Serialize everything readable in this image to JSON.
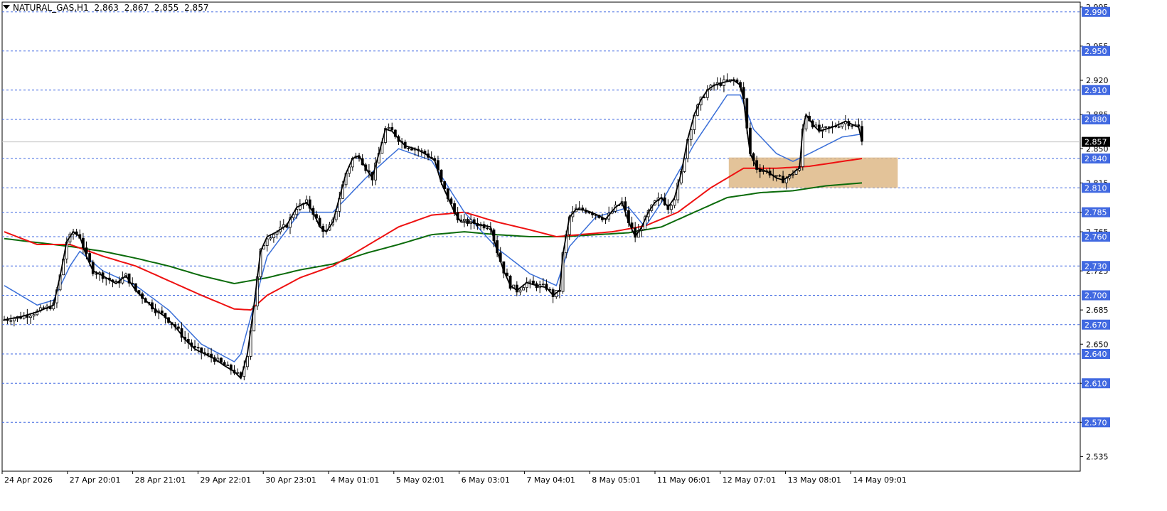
{
  "header": {
    "symbol": "NATURAL_GAS,H1",
    "open": "2.863",
    "high": "2.867",
    "low": "2.855",
    "close": "2.857"
  },
  "colors": {
    "candle": "#000000",
    "level_line": "#4169E1",
    "level_label_bg": "#4169E1",
    "price_label_bg": "#000000",
    "ma_fast": "#000000",
    "ma_blue": "#3a6fd8",
    "ma_red": "#ee1111",
    "ma_green": "#0b6b0b",
    "zone_fill": "#deb887"
  },
  "chart_data": {
    "type": "candlestick",
    "timeframe": "H1",
    "ylim": [
      2.52,
      3.0
    ],
    "y_ticks": [
      "2.995",
      "2.955",
      "2.920",
      "2.885",
      "2.850",
      "2.815",
      "2.785",
      "2.765",
      "2.725",
      "2.685",
      "2.650",
      "2.610",
      "2.570",
      "2.535"
    ],
    "x_ticks": [
      "24 Apr 2026",
      "27 Apr 20:01",
      "28 Apr 21:01",
      "29 Apr 22:01",
      "30 Apr 23:01",
      "4 May 01:01",
      "5 May 02:01",
      "6 May 03:01",
      "7 May 04:01",
      "8 May 05:01",
      "11 May 06:01",
      "12 May 07:01",
      "13 May 08:01",
      "14 May 09:01"
    ],
    "levels": [
      "2.990",
      "2.950",
      "2.910",
      "2.880",
      "2.840",
      "2.810",
      "2.785",
      "2.760",
      "2.730",
      "2.700",
      "2.670",
      "2.640",
      "2.610",
      "2.570"
    ],
    "current_price": "2.857",
    "zone": {
      "from_label": "12 May 07:01",
      "to_label": "14 May 09:01",
      "top": 2.841,
      "bottom": 2.81
    },
    "close_path": [
      [
        0,
        2.675
      ],
      [
        5,
        2.678
      ],
      [
        10,
        2.683
      ],
      [
        15,
        2.69
      ],
      [
        17,
        2.72
      ],
      [
        19,
        2.755
      ],
      [
        21,
        2.765
      ],
      [
        23,
        2.76
      ],
      [
        25,
        2.74
      ],
      [
        27,
        2.725
      ],
      [
        30,
        2.72
      ],
      [
        34,
        2.712
      ],
      [
        37,
        2.72
      ],
      [
        40,
        2.705
      ],
      [
        43,
        2.695
      ],
      [
        46,
        2.685
      ],
      [
        49,
        2.678
      ],
      [
        52,
        2.668
      ],
      [
        55,
        2.655
      ],
      [
        58,
        2.645
      ],
      [
        61,
        2.64
      ],
      [
        64,
        2.635
      ],
      [
        67,
        2.628
      ],
      [
        70,
        2.622
      ],
      [
        72,
        2.615
      ],
      [
        74,
        2.64
      ],
      [
        76,
        2.69
      ],
      [
        78,
        2.745
      ],
      [
        80,
        2.76
      ],
      [
        83,
        2.765
      ],
      [
        86,
        2.772
      ],
      [
        89,
        2.79
      ],
      [
        92,
        2.795
      ],
      [
        94,
        2.785
      ],
      [
        96,
        2.77
      ],
      [
        98,
        2.765
      ],
      [
        100,
        2.775
      ],
      [
        102,
        2.8
      ],
      [
        104,
        2.825
      ],
      [
        106,
        2.84
      ],
      [
        108,
        2.843
      ],
      [
        110,
        2.83
      ],
      [
        112,
        2.82
      ],
      [
        114,
        2.845
      ],
      [
        116,
        2.87
      ],
      [
        118,
        2.868
      ],
      [
        120,
        2.86
      ],
      [
        122,
        2.853
      ],
      [
        125,
        2.85
      ],
      [
        128,
        2.845
      ],
      [
        131,
        2.838
      ],
      [
        133,
        2.815
      ],
      [
        135,
        2.8
      ],
      [
        137,
        2.785
      ],
      [
        139,
        2.775
      ],
      [
        142,
        2.775
      ],
      [
        145,
        2.772
      ],
      [
        148,
        2.77
      ],
      [
        150,
        2.745
      ],
      [
        152,
        2.725
      ],
      [
        154,
        2.71
      ],
      [
        156,
        2.705
      ],
      [
        159,
        2.713
      ],
      [
        162,
        2.71
      ],
      [
        165,
        2.708
      ],
      [
        167,
        2.7
      ],
      [
        169,
        2.705
      ],
      [
        170,
        2.742
      ],
      [
        172,
        2.78
      ],
      [
        174,
        2.788
      ],
      [
        177,
        2.787
      ],
      [
        180,
        2.783
      ],
      [
        183,
        2.778
      ],
      [
        186,
        2.79
      ],
      [
        188,
        2.795
      ],
      [
        190,
        2.775
      ],
      [
        192,
        2.76
      ],
      [
        194,
        2.77
      ],
      [
        196,
        2.785
      ],
      [
        198,
        2.795
      ],
      [
        200,
        2.8
      ],
      [
        202,
        2.79
      ],
      [
        204,
        2.8
      ],
      [
        206,
        2.825
      ],
      [
        208,
        2.86
      ],
      [
        210,
        2.885
      ],
      [
        212,
        2.9
      ],
      [
        214,
        2.91
      ],
      [
        216,
        2.915
      ],
      [
        219,
        2.918
      ],
      [
        222,
        2.92
      ],
      [
        224,
        2.915
      ],
      [
        225,
        2.9
      ],
      [
        226,
        2.87
      ],
      [
        227,
        2.845
      ],
      [
        229,
        2.83
      ],
      [
        231,
        2.828
      ],
      [
        233,
        2.825
      ],
      [
        235,
        2.82
      ],
      [
        237,
        2.818
      ],
      [
        239,
        2.822
      ],
      [
        241,
        2.828
      ],
      [
        242,
        2.83
      ],
      [
        243,
        2.87
      ],
      [
        244,
        2.885
      ],
      [
        246,
        2.875
      ],
      [
        248,
        2.868
      ],
      [
        250,
        2.87
      ],
      [
        252,
        2.872
      ],
      [
        254,
        2.875
      ],
      [
        256,
        2.878
      ],
      [
        258,
        2.875
      ],
      [
        260,
        2.872
      ],
      [
        261,
        2.857
      ]
    ],
    "ma_paths": {
      "blue": [
        [
          0,
          2.71
        ],
        [
          10,
          2.69
        ],
        [
          15,
          2.695
        ],
        [
          20,
          2.73
        ],
        [
          23,
          2.745
        ],
        [
          30,
          2.725
        ],
        [
          40,
          2.71
        ],
        [
          50,
          2.685
        ],
        [
          60,
          2.65
        ],
        [
          70,
          2.632
        ],
        [
          72,
          2.64
        ],
        [
          76,
          2.69
        ],
        [
          80,
          2.74
        ],
        [
          90,
          2.785
        ],
        [
          100,
          2.785
        ],
        [
          110,
          2.82
        ],
        [
          120,
          2.85
        ],
        [
          130,
          2.838
        ],
        [
          140,
          2.785
        ],
        [
          150,
          2.748
        ],
        [
          160,
          2.722
        ],
        [
          168,
          2.71
        ],
        [
          172,
          2.75
        ],
        [
          180,
          2.78
        ],
        [
          190,
          2.79
        ],
        [
          195,
          2.77
        ],
        [
          200,
          2.795
        ],
        [
          210,
          2.855
        ],
        [
          220,
          2.905
        ],
        [
          224,
          2.905
        ],
        [
          228,
          2.87
        ],
        [
          235,
          2.845
        ],
        [
          240,
          2.837
        ],
        [
          245,
          2.845
        ],
        [
          255,
          2.862
        ],
        [
          261,
          2.865
        ]
      ],
      "red": [
        [
          0,
          2.765
        ],
        [
          10,
          2.752
        ],
        [
          20,
          2.752
        ],
        [
          30,
          2.74
        ],
        [
          40,
          2.73
        ],
        [
          50,
          2.715
        ],
        [
          60,
          2.7
        ],
        [
          70,
          2.686
        ],
        [
          75,
          2.685
        ],
        [
          80,
          2.7
        ],
        [
          90,
          2.718
        ],
        [
          100,
          2.73
        ],
        [
          110,
          2.75
        ],
        [
          120,
          2.77
        ],
        [
          130,
          2.782
        ],
        [
          140,
          2.785
        ],
        [
          150,
          2.775
        ],
        [
          160,
          2.767
        ],
        [
          168,
          2.76
        ],
        [
          175,
          2.762
        ],
        [
          185,
          2.765
        ],
        [
          195,
          2.771
        ],
        [
          205,
          2.785
        ],
        [
          215,
          2.81
        ],
        [
          225,
          2.83
        ],
        [
          235,
          2.83
        ],
        [
          245,
          2.832
        ],
        [
          255,
          2.837
        ],
        [
          261,
          2.84
        ]
      ],
      "green": [
        [
          0,
          2.758
        ],
        [
          20,
          2.75
        ],
        [
          30,
          2.745
        ],
        [
          40,
          2.738
        ],
        [
          50,
          2.73
        ],
        [
          60,
          2.72
        ],
        [
          70,
          2.712
        ],
        [
          80,
          2.718
        ],
        [
          90,
          2.726
        ],
        [
          100,
          2.732
        ],
        [
          110,
          2.743
        ],
        [
          120,
          2.752
        ],
        [
          130,
          2.762
        ],
        [
          140,
          2.765
        ],
        [
          150,
          2.762
        ],
        [
          160,
          2.76
        ],
        [
          170,
          2.76
        ],
        [
          180,
          2.762
        ],
        [
          190,
          2.764
        ],
        [
          200,
          2.77
        ],
        [
          210,
          2.785
        ],
        [
          220,
          2.8
        ],
        [
          230,
          2.805
        ],
        [
          240,
          2.807
        ],
        [
          250,
          2.812
        ],
        [
          261,
          2.815
        ]
      ]
    }
  }
}
